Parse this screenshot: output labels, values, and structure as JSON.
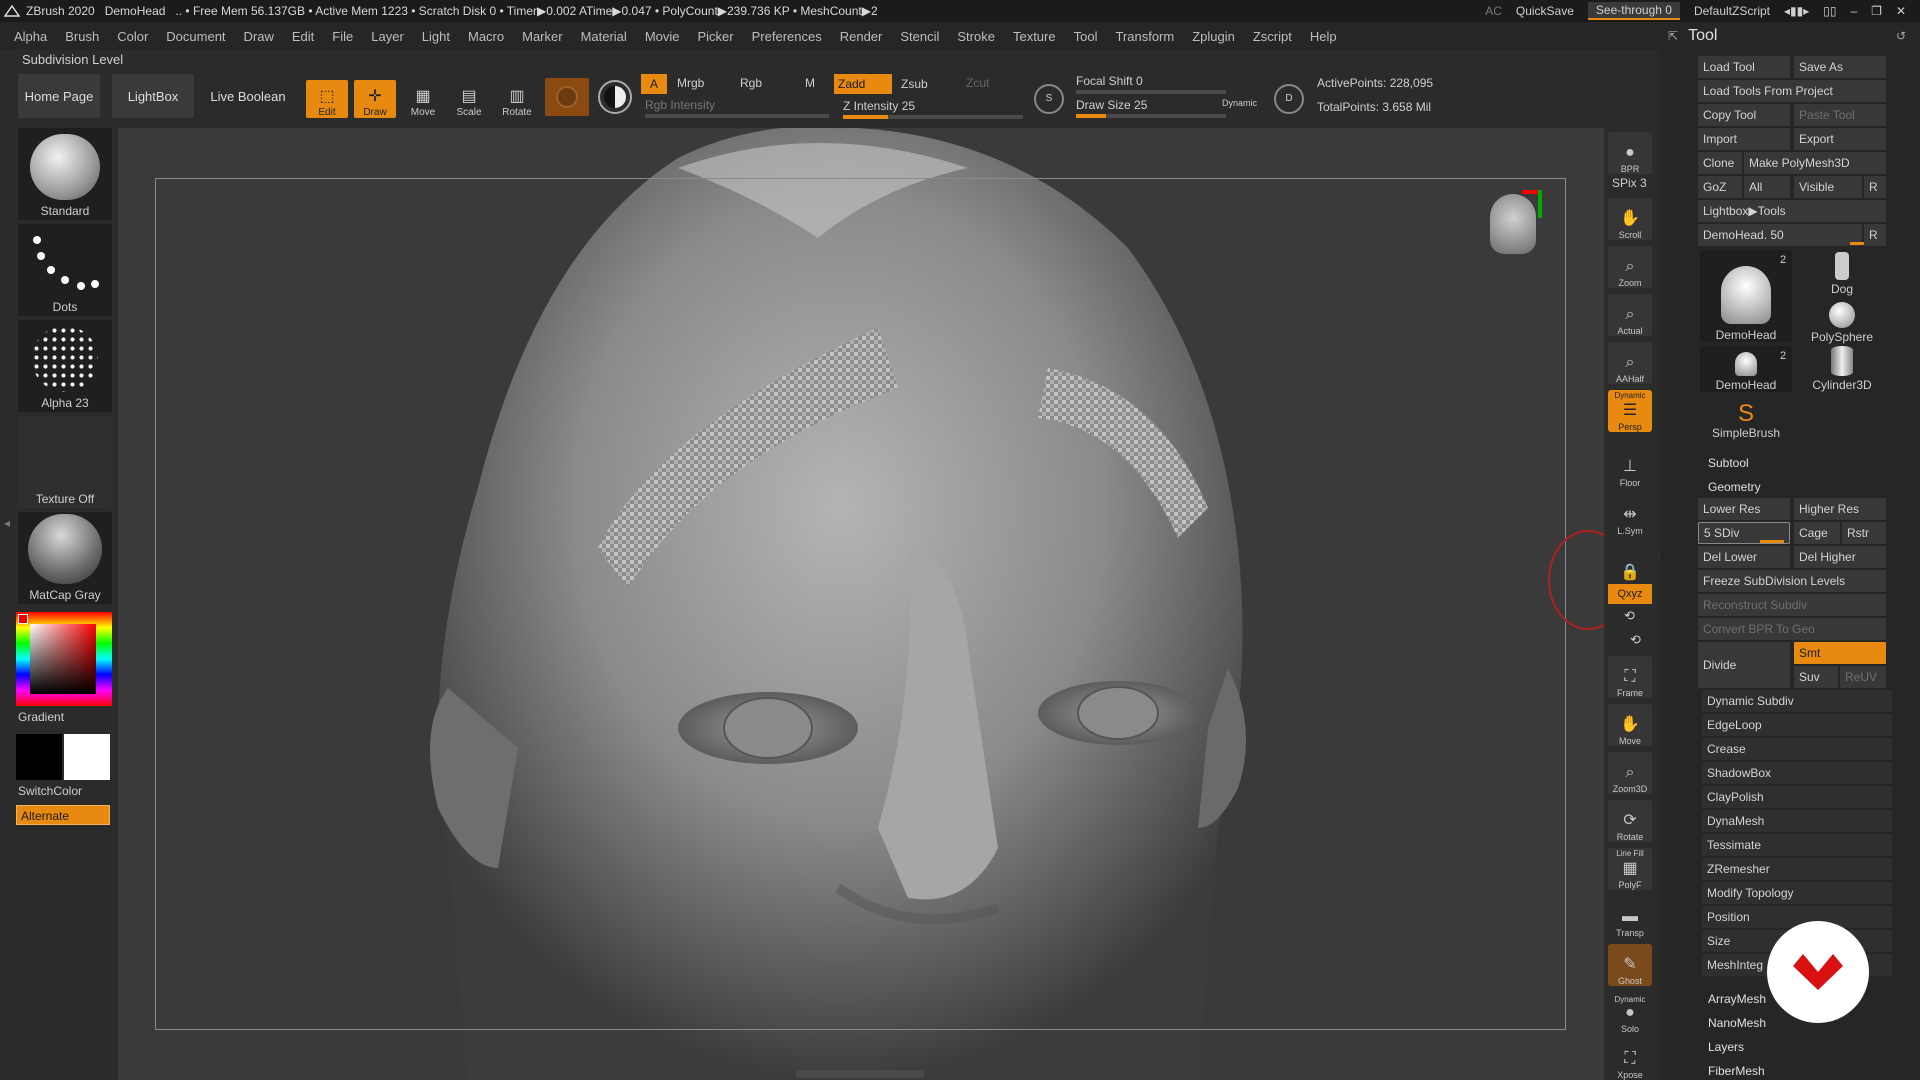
{
  "titlebar": {
    "app": "ZBrush 2020",
    "document": "DemoHead",
    "status": ".. • Free Mem 56.137GB • Active Mem 1223 • Scratch Disk 0 • Timer▶0.002 ATime▶0.047 • PolyCount▶239.736 KP • MeshCount▶2",
    "ac": "AC",
    "quicksave": "QuickSave",
    "see_through": "See-through  0",
    "script": "DefaultZScript"
  },
  "menu": [
    "Alpha",
    "Brush",
    "Color",
    "Document",
    "Draw",
    "Edit",
    "File",
    "Layer",
    "Light",
    "Macro",
    "Marker",
    "Material",
    "Movie",
    "Picker",
    "Preferences",
    "Render",
    "Stencil",
    "Stroke",
    "Texture",
    "Tool",
    "Transform",
    "Zplugin",
    "Zscript",
    "Help"
  ],
  "subdivision_label": "Subdivision Level",
  "toolbar": {
    "home": "Home Page",
    "lightbox": "LightBox",
    "live_boolean": "Live Boolean",
    "edit": "Edit",
    "draw": "Draw",
    "move": "Move",
    "scale": "Scale",
    "rotate": "Rotate",
    "a": "A",
    "mrgb": "Mrgb",
    "rgb": "Rgb",
    "m": "M",
    "zadd": "Zadd",
    "zsub": "Zsub",
    "zcut": "Zcut",
    "rgb_intensity": "Rgb Intensity",
    "z_intensity": "Z Intensity 25",
    "focal_shift": "Focal Shift 0",
    "draw_size": "Draw Size 25",
    "dynamic": "Dynamic",
    "active_points": "ActivePoints: 228,095",
    "total_points": "TotalPoints: 3.658 Mil",
    "z_intensity_value": 0.25,
    "draw_size_value": 0.2
  },
  "left_shelf": {
    "brush": "Standard",
    "stroke": "Dots",
    "alpha": "Alpha 23",
    "texture": "Texture Off",
    "material": "MatCap Gray",
    "gradient": "Gradient",
    "switch_color": "SwitchColor",
    "alternate": "Alternate"
  },
  "right_dock": {
    "bpr": "BPR",
    "spix": "SPix 3",
    "scroll": "Scroll",
    "zoom": "Zoom",
    "actual": "Actual",
    "aahalf": "AAHalf",
    "dynamic_top": "Dynamic",
    "persp": "Persp",
    "floor": "Floor",
    "lsym": "L.Sym",
    "xyz": "Qxyz",
    "frame": "Frame",
    "move": "Move",
    "zoom3d": "Zoom3D",
    "rotate": "Rotate",
    "line_fill": "Line Fill",
    "polyf": "PolyF",
    "transp": "Transp",
    "ghost": "Ghost",
    "dynamic_solo": "Dynamic",
    "solo": "Solo",
    "xpose": "Xpose"
  },
  "tool_panel": {
    "title": "Tool",
    "load_tool": "Load Tool",
    "save_as": "Save As",
    "load_from_project": "Load Tools From Project",
    "copy_tool": "Copy Tool",
    "paste_tool": "Paste Tool",
    "import": "Import",
    "export": "Export",
    "clone": "Clone",
    "make_polymesh": "Make PolyMesh3D",
    "goz": "GoZ",
    "all": "All",
    "visible": "Visible",
    "r": "R",
    "lightbox_tools": "Lightbox▶Tools",
    "current_tool": "DemoHead. 50",
    "thumbs": [
      {
        "label": "DemoHead",
        "badge": "2"
      },
      {
        "label": "Dog",
        "badge": ""
      },
      {
        "label": "PolySphere",
        "badge": ""
      },
      {
        "label": "DemoHead",
        "badge": "2"
      },
      {
        "label": "Cylinder3D",
        "badge": ""
      },
      {
        "label": "SimpleBrush",
        "badge": ""
      }
    ],
    "subtool": "Subtool",
    "geometry": "Geometry",
    "lower_res": "Lower Res",
    "higher_res": "Higher Res",
    "sdiv": "5 SDiv",
    "cage": "Cage",
    "rstr": "Rstr",
    "del_lower": "Del Lower",
    "del_higher": "Del Higher",
    "freeze": "Freeze SubDivision Levels",
    "reconstruct": "Reconstruct Subdiv",
    "convert_bpr": "Convert BPR To Geo",
    "divide": "Divide",
    "smt": "Smt",
    "suv": "Suv",
    "reuv": "ReUV",
    "sections": [
      "Dynamic Subdiv",
      "EdgeLoop",
      "Crease",
      "ShadowBox",
      "ClayPolish",
      "DynaMesh",
      "Tessimate",
      "ZRemesher",
      "Modify Topology",
      "Position",
      "Size",
      "MeshInteg"
    ],
    "more": [
      "ArrayMesh",
      "NanoMesh",
      "Layers",
      "FiberMesh"
    ]
  },
  "colors": {
    "accent": "#e88a10",
    "bg": "#2b2b2b",
    "canvas": "#3a3a3a"
  }
}
